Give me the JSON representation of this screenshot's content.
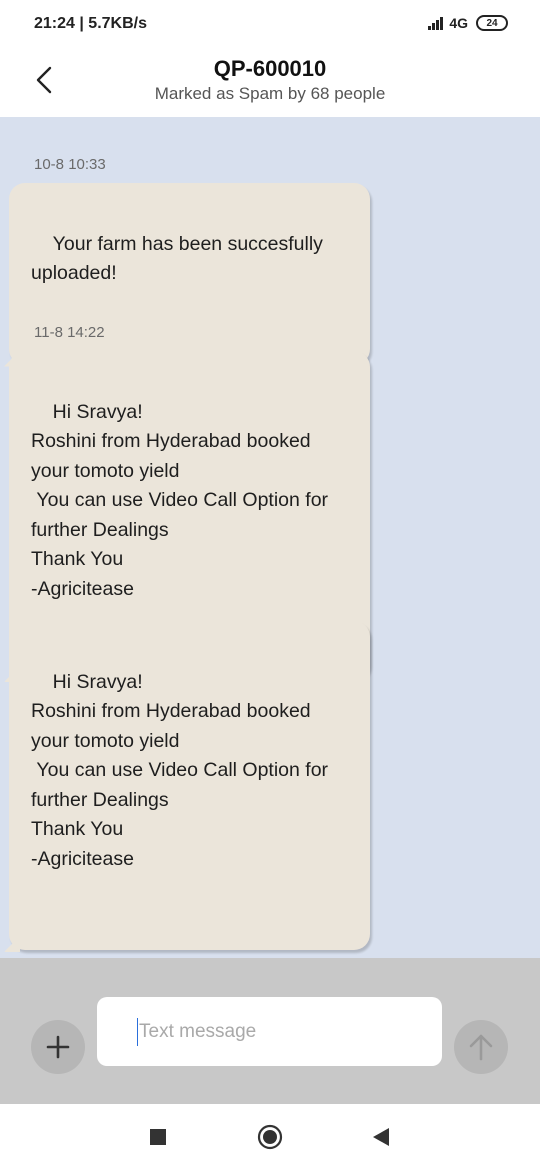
{
  "status_bar": {
    "time_speed": "21:24 | 5.7KB/s",
    "network": "4G",
    "battery": "24"
  },
  "header": {
    "title": "QP-600010",
    "subtitle": "Marked as Spam by 68 people"
  },
  "messages": [
    {
      "timestamp": "10-8 10:33",
      "text": "Your farm has been succesfully\nuploaded!"
    },
    {
      "timestamp": "11-8 14:22",
      "text": "Hi Sravya!\nRoshini from Hyderabad booked\nyour tomoto yield\n You can use Video Call Option for\nfurther Dealings\nThank You\n-Agricitease"
    },
    {
      "timestamp": "",
      "text": "Hi Sravya!\nRoshini from Hyderabad booked\nyour tomoto yield\n You can use Video Call Option for\nfurther Dealings\nThank You\n-Agricitease"
    }
  ],
  "composer": {
    "placeholder": "Text message",
    "value": ""
  },
  "icons": {
    "back": "back-arrow-icon",
    "add": "plus-icon",
    "send": "send-arrow-icon",
    "nav_recents": "square-icon",
    "nav_home": "circle-icon",
    "nav_back": "triangle-back-icon"
  },
  "colors": {
    "chat_background": "#d8e0ee",
    "bubble": "#ebe5da",
    "composer_background": "#c8c8c8"
  }
}
